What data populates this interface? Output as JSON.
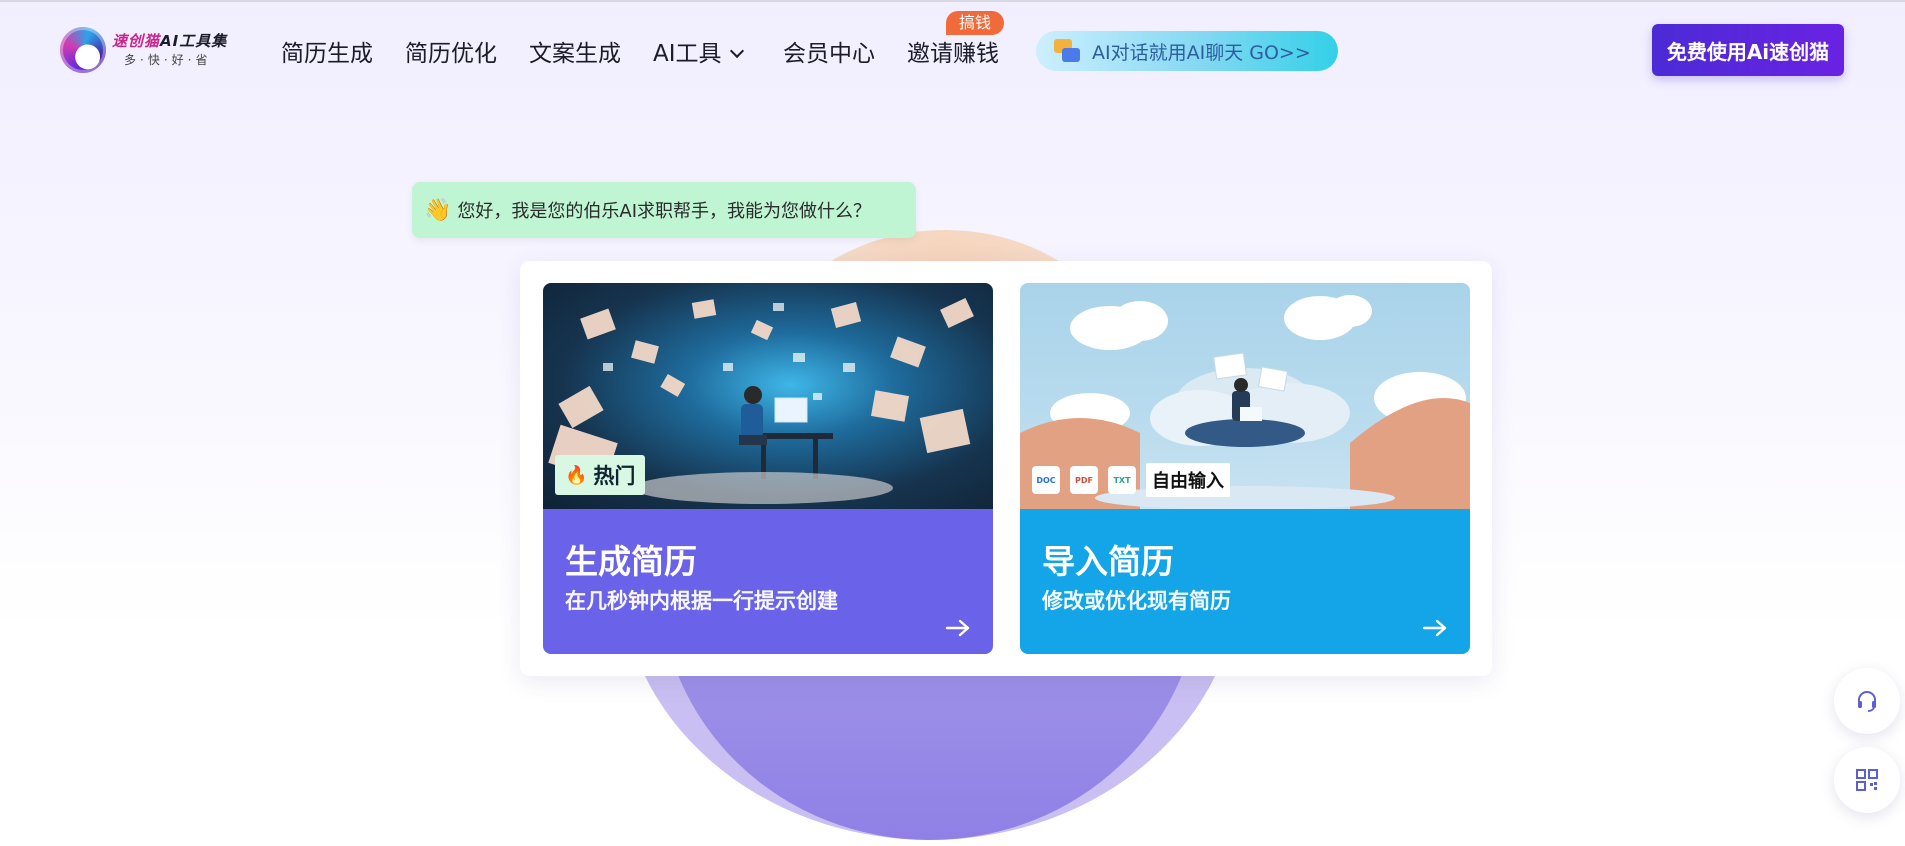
{
  "header": {
    "logo": {
      "title_part1": "速创猫",
      "title_part2": "AI工具集",
      "subtitle": "多·快·好·省",
      "icon": "cat-logo-icon"
    },
    "nav": [
      {
        "label": "简历生成"
      },
      {
        "label": "简历优化"
      },
      {
        "label": "文案生成"
      },
      {
        "label": "AI工具",
        "icon": "chevron-down-icon"
      },
      {
        "label": "会员中心"
      },
      {
        "label": "邀请赚钱",
        "badge": "搞钱"
      }
    ],
    "chat_pill": {
      "icon": "chat-bubbles-icon",
      "label": "AI对话就用AI聊天 GO>>"
    },
    "cta_label": "免费使用Ai速创猫"
  },
  "greeting": {
    "emoji": "👋",
    "text": "您好，我是您的伯乐AI求职帮手，我能为您做什么？"
  },
  "cards": [
    {
      "title": "生成简历",
      "subtitle": "在几秒钟内根据一行提示创建",
      "tag": "热门",
      "tag_icon": "flame-icon",
      "arrow": "arrow-right-icon",
      "color": "#6a63ea"
    },
    {
      "title": "导入简历",
      "subtitle": "修改或优化现有简历",
      "file_types": [
        "DOC",
        "PDF",
        "TXT"
      ],
      "tag": "自由输入",
      "arrow": "arrow-right-icon",
      "color": "#13a5e8"
    }
  ],
  "floating": [
    {
      "icon": "headset-icon"
    },
    {
      "icon": "qr-code-icon"
    }
  ],
  "colors": {
    "brand": "#5b27dc",
    "greeting_bg": "#bff5d2",
    "hot_badge": "#f06a3a"
  }
}
